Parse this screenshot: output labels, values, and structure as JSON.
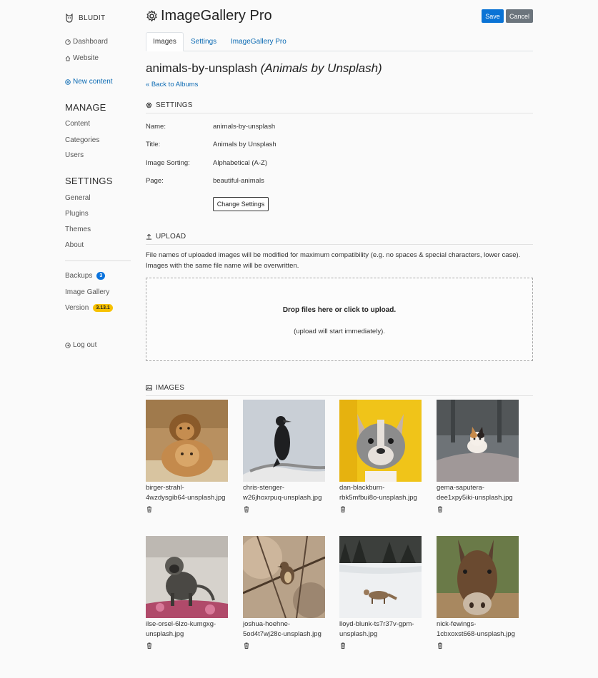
{
  "sidebar": {
    "brand": "BLUDIT",
    "dashboard": "Dashboard",
    "website": "Website",
    "new_content": "New content",
    "manage_heading": "MANAGE",
    "content": "Content",
    "categories": "Categories",
    "users": "Users",
    "settings_heading": "SETTINGS",
    "general": "General",
    "plugins": "Plugins",
    "themes": "Themes",
    "about": "About",
    "backups": "Backups",
    "backups_count": "3",
    "image_gallery": "Image Gallery",
    "version": "Version",
    "version_number": "3.13.1",
    "logout": "Log out"
  },
  "header": {
    "title": "ImageGallery Pro",
    "save": "Save",
    "cancel": "Cancel"
  },
  "tabs": [
    "Images",
    "Settings",
    "ImageGallery Pro"
  ],
  "album": {
    "name": "animals-by-unsplash",
    "title_italic": "(Animals by Unsplash)",
    "back": "« Back to Albums"
  },
  "settings": {
    "heading": "SETTINGS",
    "rows": [
      {
        "label": "Name:",
        "value": "animals-by-unsplash"
      },
      {
        "label": "Title:",
        "value": "Animals by Unsplash"
      },
      {
        "label": "Image Sorting:",
        "value": "Alphabetical (A-Z)"
      },
      {
        "label": "Page:",
        "value": "beautiful-animals"
      }
    ],
    "change_button": "Change Settings"
  },
  "upload": {
    "heading": "UPLOAD",
    "info_line1": "File names of uploaded images will be modified for maximum compatibility (e.g. no spaces & special characters, lower case).",
    "info_line2": "Images with the same file name will be overwritten.",
    "drop_title": "Drop files here or click to upload.",
    "drop_sub": "(upload will start immediately)."
  },
  "images": {
    "heading": "IMAGES",
    "items": [
      {
        "line1": "birger-strahl-",
        "line2": "4wzdysgib64-unsplash.jpg",
        "icon": "lion-photo-icon"
      },
      {
        "line1": "chris-stenger-",
        "line2": "w26jhoxrpuq-unsplash.jpg",
        "icon": "cormorant-photo-icon"
      },
      {
        "line1": "dan-blackburn-",
        "line2": "rbk5mfbui8o-unsplash.jpg",
        "icon": "bulldog-photo-icon"
      },
      {
        "line1": "gema-saputera-",
        "line2": "dee1xpy5iki-unsplash.jpg",
        "icon": "cat-photo-icon"
      },
      {
        "line1": "ilse-orsel-6lzo-kumgxg-",
        "line2": "unsplash.jpg",
        "icon": "monkey-photo-icon"
      },
      {
        "line1": "joshua-hoehne-",
        "line2": "5od4t7wj28c-unsplash.jpg",
        "icon": "bird-photo-icon"
      },
      {
        "line1": "lloyd-blunk-ts7r37v-gpm-",
        "line2": "unsplash.jpg",
        "icon": "coyote-photo-icon"
      },
      {
        "line1": "nick-fewings-",
        "line2": "1cbxoxst668-unsplash.jpg",
        "icon": "donkey-photo-icon"
      }
    ]
  },
  "colors": {
    "accent": "#0a73d5",
    "link": "#0b6ab3",
    "badge_blue": "#0a73dd",
    "badge_yellow": "#f7c100",
    "cancel": "#6c757d"
  }
}
